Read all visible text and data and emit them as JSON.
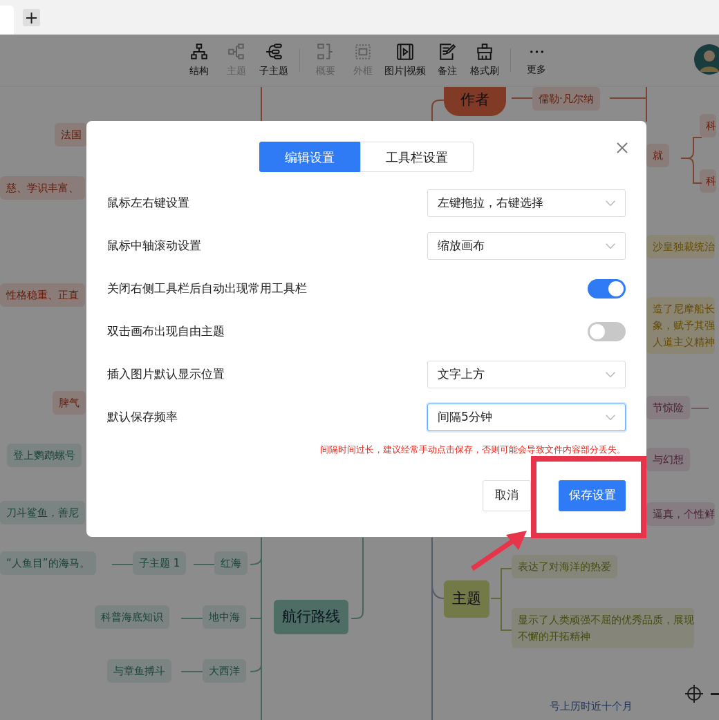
{
  "browser": {
    "new_tab_label": "+"
  },
  "toolbar": {
    "groups": [
      [
        {
          "label": "结构",
          "kind": "structure",
          "disabled": false
        },
        {
          "label": "主题",
          "kind": "topic",
          "disabled": true
        },
        {
          "label": "子主题",
          "kind": "subtopic",
          "disabled": false
        }
      ],
      [
        {
          "label": "概要",
          "kind": "summary",
          "disabled": true
        },
        {
          "label": "外框",
          "kind": "frame",
          "disabled": true
        },
        {
          "label": "图片|视频",
          "kind": "media",
          "disabled": false
        },
        {
          "label": "备注",
          "kind": "note",
          "disabled": false
        },
        {
          "label": "格式刷",
          "kind": "brush",
          "disabled": false
        }
      ],
      [
        {
          "label": "更多",
          "kind": "more",
          "disabled": false
        }
      ]
    ]
  },
  "canvas": {
    "nodes": [
      {
        "text": "法国",
        "kind": "red"
      },
      {
        "text": "慈、学识丰富、",
        "kind": "red"
      },
      {
        "text": "性格稳重、正直",
        "kind": "red"
      },
      {
        "text": "脾气",
        "kind": "red"
      },
      {
        "text": "登上鹦鹉螺号",
        "kind": "teal"
      },
      {
        "text": "刀斗鲨鱼，善尼",
        "kind": "teal"
      },
      {
        "text": "“人鱼目”的海马。",
        "kind": "teal"
      },
      {
        "text": "子主题 1",
        "kind": "teal"
      },
      {
        "text": "红海",
        "kind": "teal"
      },
      {
        "text": "科普海底知识",
        "kind": "teal"
      },
      {
        "text": "地中海",
        "kind": "teal"
      },
      {
        "text": "航行路线",
        "kind": "teal-main"
      },
      {
        "text": "与章鱼搏斗",
        "kind": "teal"
      },
      {
        "text": "大西洋",
        "kind": "teal"
      },
      {
        "text": "作者",
        "kind": "red-main"
      },
      {
        "text": "儒勒·凡尔纳",
        "kind": "red"
      },
      {
        "text": "就",
        "kind": "red"
      },
      {
        "text": "科",
        "kind": "red"
      },
      {
        "text": "科",
        "kind": "red"
      },
      {
        "text": "沙皇独裁统治",
        "kind": "yellow"
      },
      {
        "lines": [
          "造了尼摩船长",
          "象，赋予其强",
          "人道主义精神"
        ],
        "kind": "yellow"
      },
      {
        "text": "节惊险",
        "kind": "purple"
      },
      {
        "text": "与幻想",
        "kind": "purple"
      },
      {
        "text": "逼真，个性鲜",
        "kind": "purple"
      },
      {
        "text": "表达了对海洋的热爱",
        "kind": "olive"
      },
      {
        "text": "主题",
        "kind": "olive-main"
      },
      {
        "lines": [
          "显示了人类顽强不屈的优秀品质，展现",
          "不懈的开拓精神"
        ],
        "kind": "olive"
      },
      {
        "text": "号上历时近十个月",
        "kind": "blue"
      }
    ]
  },
  "dialog": {
    "tabs": [
      {
        "label": "编辑设置",
        "selected": true
      },
      {
        "label": "工具栏设置",
        "selected": false
      }
    ],
    "settings": [
      {
        "label": "鼠标左右键设置",
        "kind": "select",
        "value": "左键拖拉，右键选择",
        "focused": false
      },
      {
        "label": "鼠标中轴滚动设置",
        "kind": "select",
        "value": "缩放画布",
        "focused": false
      },
      {
        "label": "关闭右侧工具栏后自动出现常用工具栏",
        "kind": "toggle",
        "on": true
      },
      {
        "label": "双击画布出现自由主题",
        "kind": "toggle",
        "on": false
      },
      {
        "label": "插入图片默认显示位置",
        "kind": "select",
        "value": "文字上方",
        "focused": false
      },
      {
        "label": "默认保存频率",
        "kind": "select",
        "value": "间隔5分钟",
        "focused": true
      }
    ],
    "warning": "间隔时间过长，建议经常手动点击保存，否则可能会导致文件内容部分丢失。",
    "buttons": [
      {
        "label": "取消",
        "kind": "secondary"
      },
      {
        "label": "保存设置",
        "kind": "primary"
      }
    ]
  }
}
